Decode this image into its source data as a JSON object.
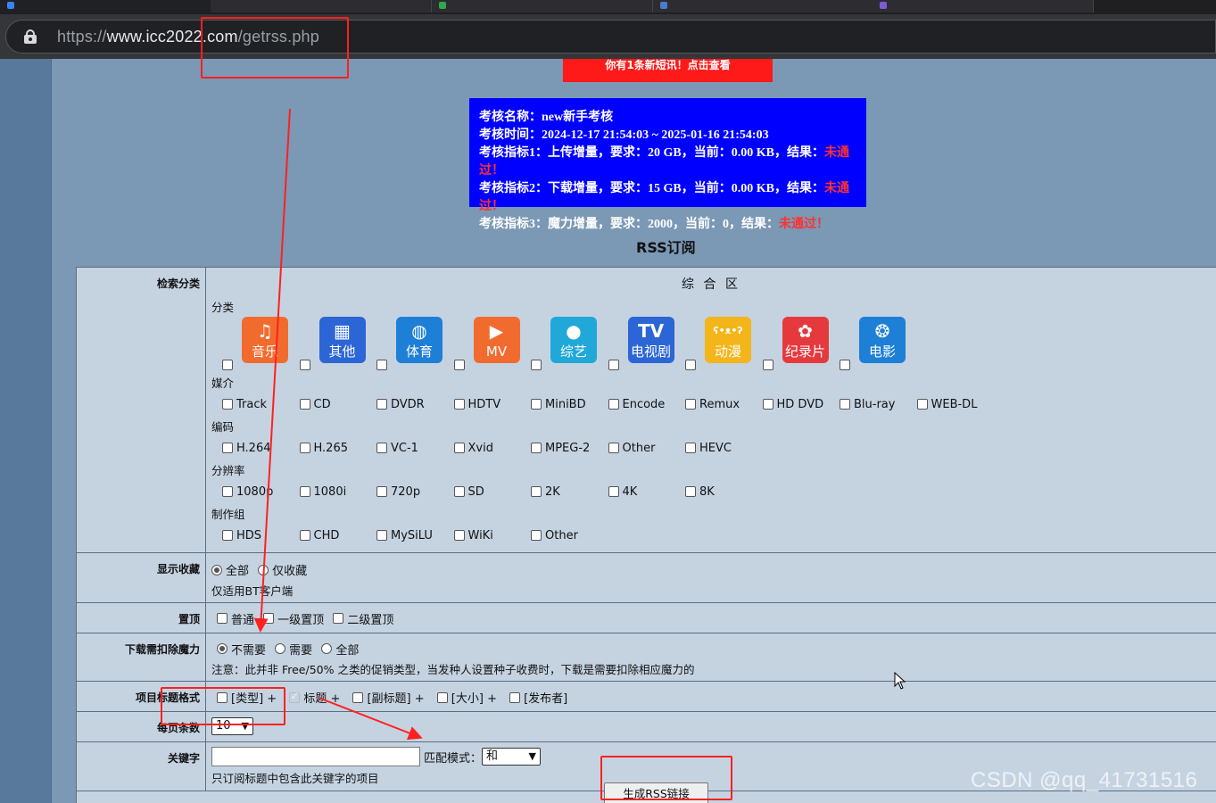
{
  "browser": {
    "url_prefix": "https://",
    "url_host": "www.icc2022.com",
    "url_path": "/getrss.php"
  },
  "notice": "你有1条新短讯！点击查看",
  "exam": {
    "line1": "考核名称：new新手考核",
    "line2": "考核时间：2024-12-17 21:54:03 ~ 2025-01-16 21:54:03",
    "line3": "考核指标1：上传增量，要求：20 GB，当前：0.00 KB，结果：",
    "line4": "考核指标2：下载增量，要求：15 GB，当前：0.00 KB，结果：",
    "line5": "考核指标3：魔力增量，要求：2000，当前：0，结果：",
    "fail": "未通过！"
  },
  "page_title": "RSS订阅",
  "rows": {
    "category": {
      "label": "检索分类",
      "zone": "综 合 区",
      "sub_category": "分类",
      "categories": [
        {
          "name": "音乐",
          "icon": "music-note-icon",
          "color": "#f26b2e"
        },
        {
          "name": "其他",
          "icon": "grid-icon",
          "color": "#2c66d6"
        },
        {
          "name": "体育",
          "icon": "basketball-icon",
          "color": "#1e7fd6"
        },
        {
          "name": "MV",
          "icon": "video-camera-icon",
          "color": "#f26b2e"
        },
        {
          "name": "综艺",
          "icon": "microphone-icon",
          "color": "#1fa8d8"
        },
        {
          "name": "电视剧",
          "icon": "tv-icon",
          "color": "#2c66d6"
        },
        {
          "name": "动漫",
          "icon": "bear-face-icon",
          "color": "#f3b51a"
        },
        {
          "name": "纪录片",
          "icon": "pinwheel-icon",
          "color": "#e6393e"
        },
        {
          "name": "电影",
          "icon": "film-reel-icon",
          "color": "#1e7fd6"
        }
      ],
      "sub_medium": "媒介",
      "medium": [
        "Track",
        "CD",
        "DVDR",
        "HDTV",
        "MiniBD",
        "Encode",
        "Remux",
        "HD DVD",
        "Blu-ray",
        "WEB-DL"
      ],
      "sub_codec": "编码",
      "codec": [
        "H.264",
        "H.265",
        "VC-1",
        "Xvid",
        "MPEG-2",
        "Other",
        "HEVC"
      ],
      "sub_resolution": "分辨率",
      "resolution": [
        "1080p",
        "1080i",
        "720p",
        "SD",
        "2K",
        "4K",
        "8K"
      ],
      "sub_team": "制作组",
      "team": [
        "HDS",
        "CHD",
        "MySiLU",
        "WiKi",
        "Other"
      ]
    },
    "favorites": {
      "label": "显示收藏",
      "opt_all": "全部",
      "opt_only": "仅收藏",
      "note": "仅适用BT客户端"
    },
    "sticky": {
      "label": "置顶",
      "opt1": "普通",
      "opt2": "一级置顶",
      "opt3": "二级置顶"
    },
    "magic": {
      "label": "下载需扣除魔力",
      "opt1": "不需要",
      "opt2": "需要",
      "opt3": "全部",
      "note": "注意：此并非 Free/50% 之类的促销类型，当发种人设置种子收费时，下载是需要扣除相应魔力的"
    },
    "title_format": {
      "label": "项目标题格式",
      "opt1": "[类型] +",
      "opt2": "标题 +",
      "opt3": "[副标题] +",
      "opt4": "[大小] +",
      "opt5": "[发布者]"
    },
    "per_page": {
      "label": "每页条数",
      "value": "10"
    },
    "keyword": {
      "label": "关键字",
      "match_label": "匹配模式：",
      "match_value": "和",
      "note": "只订阅标题中包含此关键字的项目"
    }
  },
  "submit_label": "生成RSS链接",
  "watermark": "CSDN @qq_41731516",
  "colors": {
    "page_bg": "#7b98b5",
    "form_bg": "#c5d3e1",
    "notice_bg": "#ff1a1a",
    "exam_bg": "#0000ff",
    "fail_text": "#ff3030",
    "annotation_red": "#ff2020"
  }
}
